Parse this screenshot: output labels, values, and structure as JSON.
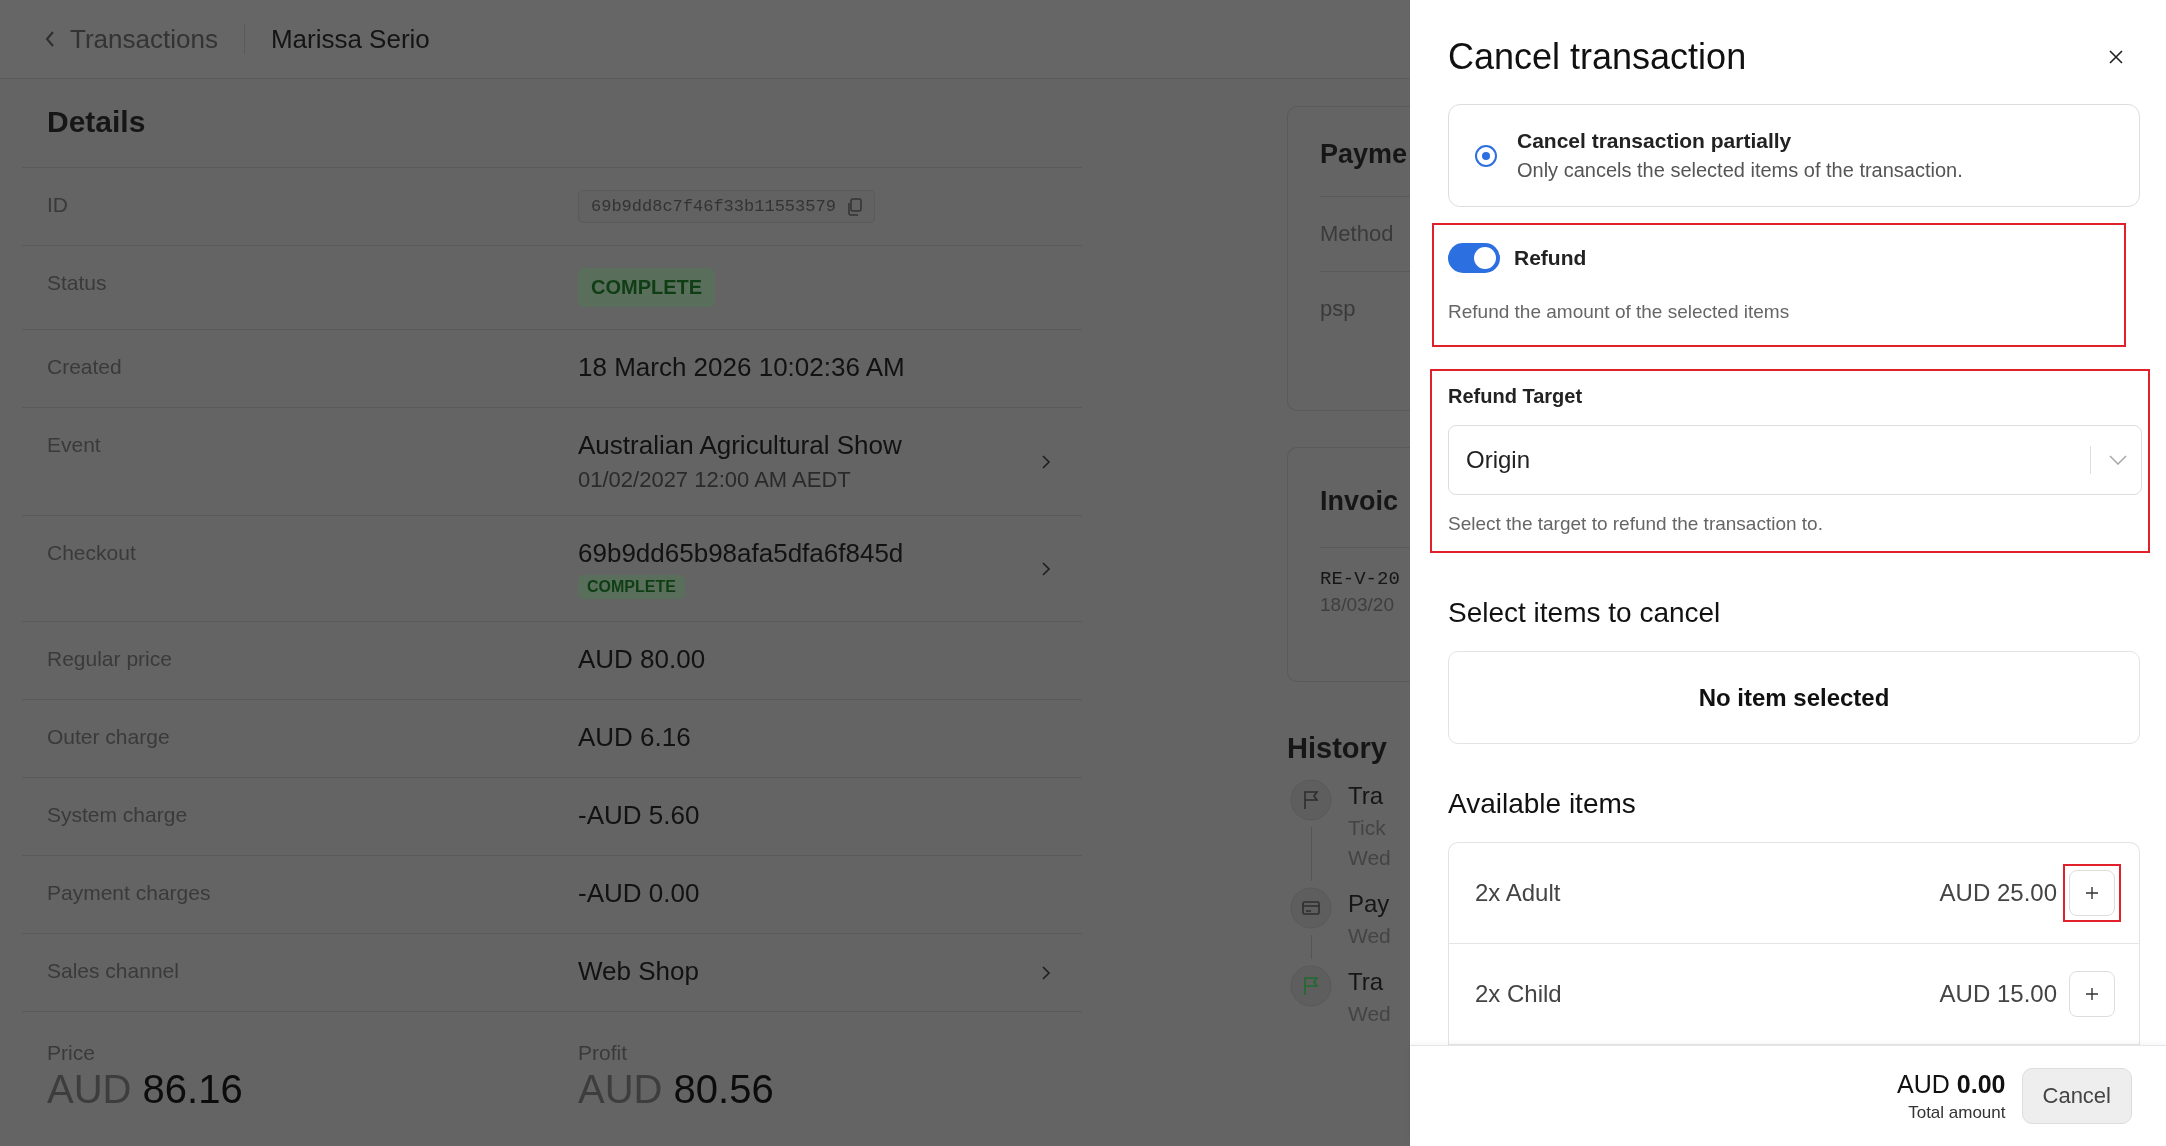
{
  "breadcrumb": {
    "back": "Transactions",
    "current": "Marissa Serio"
  },
  "details": {
    "title": "Details",
    "rows": [
      {
        "kind": "code",
        "label": "ID",
        "value": "69b9dd8c7f46f33b11553579"
      },
      {
        "kind": "badge",
        "label": "Status",
        "value": "COMPLETE"
      },
      {
        "kind": "text",
        "label": "Created",
        "value": "18 March 2026 10:02:36 AM"
      },
      {
        "kind": "link",
        "label": "Event",
        "value": "Australian Agricultural Show",
        "subtitle": "01/02/2027 12:00 AM AEDT"
      },
      {
        "kind": "link",
        "label": "Checkout",
        "value": "69b9dd65b98afa5dfa6f845d",
        "badge": "COMPLETE"
      },
      {
        "kind": "text",
        "label": "Regular price",
        "value": "AUD 80.00"
      },
      {
        "kind": "text",
        "label": "Outer charge",
        "value": "AUD 6.16"
      },
      {
        "kind": "text",
        "label": "System charge",
        "value": "-AUD 5.60"
      },
      {
        "kind": "text",
        "label": "Payment charges",
        "value": "-AUD 0.00"
      },
      {
        "kind": "link",
        "label": "Sales channel",
        "value": "Web Shop"
      }
    ],
    "totals": [
      {
        "label": "Price",
        "currency": "AUD",
        "amount": "86.16"
      },
      {
        "label": "Profit",
        "currency": "AUD",
        "amount": "80.56"
      }
    ]
  },
  "payment": {
    "title": "Payme",
    "rows": [
      "Method",
      "psp"
    ]
  },
  "invoice": {
    "title": "Invoic",
    "number": "RE-V-20",
    "date": "18/03/20"
  },
  "history": {
    "title": "History",
    "entries": [
      {
        "kind": "flag",
        "lines": [
          "Tra",
          "Tick",
          "Wed"
        ]
      },
      {
        "kind": "payment",
        "lines": [
          "Pay",
          "Wed"
        ]
      },
      {
        "kind": "completed",
        "lines": [
          "Tra",
          "Wed"
        ]
      }
    ]
  },
  "cancel_panel": {
    "title": "Cancel transaction",
    "options": [
      {
        "label": "Cancel transaction partially",
        "description": "Only cancels the selected items of the transaction.",
        "selected": true
      }
    ],
    "refund": {
      "label": "Refund",
      "on": true,
      "description": "Refund the amount of the selected items",
      "highlighted": true
    },
    "refund_target": {
      "label": "Refund Target",
      "value": "Origin",
      "helper": "Select the target to refund the transaction to.",
      "highlighted": true
    },
    "selected_section": {
      "title": "Select items to cancel",
      "empty_text": "No item selected"
    },
    "available_section": {
      "title": "Available items",
      "items": [
        {
          "name": "2x Adult",
          "price": "AUD 25.00",
          "highlighted": true
        },
        {
          "name": "2x Child",
          "price": "AUD 15.00",
          "highlighted": false
        }
      ]
    },
    "footer": {
      "currency": "AUD",
      "amount": "0.00",
      "caption": "Total amount",
      "button": "Cancel"
    }
  }
}
